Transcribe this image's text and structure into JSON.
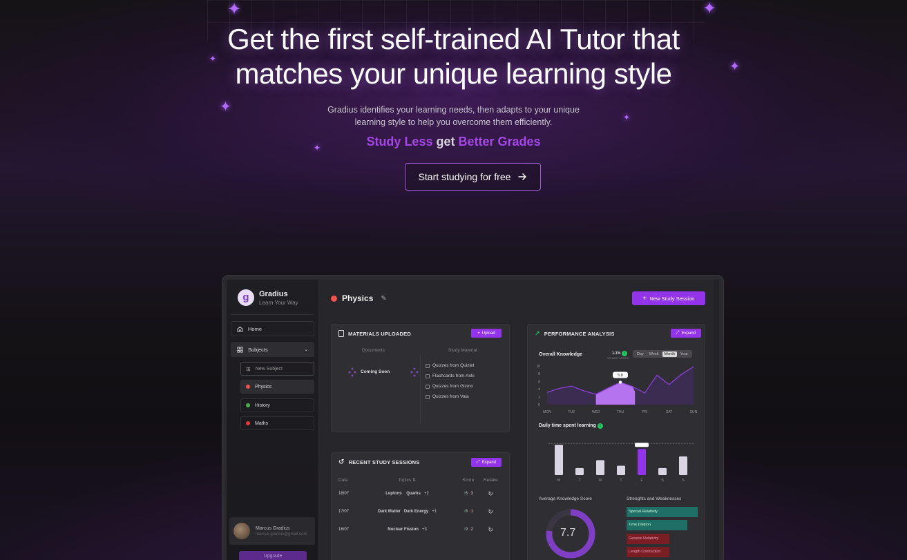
{
  "hero": {
    "title_line1": "Get the first self-trained AI Tutor that",
    "title_line2": "matches your unique learning style",
    "subtitle_line1": "Gradius identifies your learning needs, then adapts to your unique",
    "subtitle_line2": "learning style to help you overcome them efficiently.",
    "tagline_part1": "Study Less",
    "tagline_part2": "get",
    "tagline_part3": "Better Grades",
    "cta_label": "Start studying for free",
    "cta_icon": "arrow-right-icon"
  },
  "colors": {
    "accent": "#9333ea",
    "tagline_purple": "#a447e6",
    "background": "#121113"
  },
  "app": {
    "brand": {
      "name": "Gradius",
      "tagline": "Learn Your Way",
      "logo_letter": "g"
    },
    "sidebar": {
      "home": "Home",
      "subjects": "Subjects",
      "new_subject": "New Subject",
      "items": [
        {
          "label": "Physics",
          "color": "#ef5350"
        },
        {
          "label": "History",
          "color": "#4caf50"
        },
        {
          "label": "Maths",
          "color": "#e53935"
        }
      ],
      "user_name": "Marcus Gradius",
      "user_email": "marcus.gradius@gmail.com",
      "upgrade": "Upgrade"
    },
    "header": {
      "subject": "Physics",
      "subject_color": "#ef5350",
      "new_session": "New Study Session"
    },
    "materials": {
      "title": "MATERIALS UPLOADED",
      "upload": "Upload",
      "documents_header": "Documents",
      "study_material_header": "Study Material",
      "coming_soon": "Coming Soon",
      "items": [
        "Quizzes from Quizlet",
        "Flashcards from Anki",
        "Quizzes from Gizmo",
        "Quizzes from Vaia"
      ]
    },
    "sessions": {
      "title": "RECENT STUDY SESSIONS",
      "expand": "Expand",
      "headers": [
        "Date",
        "Topics",
        "Score",
        "Retake"
      ],
      "rows": [
        {
          "date": "18/07",
          "topic1": "Leptons",
          "topic2": "Quarks",
          "more": "+2",
          "up": "6",
          "down": "3"
        },
        {
          "date": "17/07",
          "topic1": "Dark Matter",
          "topic2": "Dark Energy",
          "more": "+1",
          "up": "8",
          "down": "1"
        },
        {
          "date": "16/07",
          "topic1": "Nuclear Fission",
          "topic2": "",
          "more": "+3",
          "up": "9",
          "down": "2"
        }
      ]
    },
    "performance": {
      "title": "PERFORMANCE ANALYSIS",
      "expand": "Expand",
      "overall_label": "Overall Knowledge",
      "overall_change": "1.3%",
      "overall_caption": "VS LAST MONTH",
      "ranges": [
        "Day",
        "Week",
        "Month",
        "Year"
      ],
      "selected_range": "Month",
      "daily_label": "Daily time spent learning",
      "avg_label": "Average Knowledge Score",
      "avg_score": "7.7",
      "sw_label": "Strenghts and Weaknesses",
      "strengths": [
        {
          "label": "Special Relativity",
          "color": "#1f6f66"
        },
        {
          "label": "Time Dilation",
          "color": "#1f6f66"
        },
        {
          "label": "General Relativity",
          "color": "#7a1e24"
        },
        {
          "label": "Length Contraction",
          "color": "#7a1e24"
        }
      ]
    }
  },
  "chart_data": [
    {
      "type": "area",
      "title": "Overall Knowledge",
      "categories": [
        "MON",
        "TUE",
        "WED",
        "THU",
        "FRI",
        "SAT",
        "SUN"
      ],
      "x": [
        0,
        0.5,
        1,
        1.5,
        2,
        2.5,
        3,
        3.5,
        4,
        4.5,
        5,
        5.5,
        6
      ],
      "values": [
        3.2,
        4.2,
        4.8,
        3.6,
        2.7,
        4.3,
        5.8,
        4.7,
        3.0,
        7.6,
        5.2,
        7.8,
        9.8
      ],
      "highlight_label": "5.8",
      "yticks": [
        0,
        2,
        4,
        6,
        8,
        10
      ],
      "ylim": [
        0,
        10
      ]
    },
    {
      "type": "bar",
      "title": "Daily time spent learning",
      "categories": [
        "M",
        "T",
        "W",
        "T",
        "F",
        "S",
        "S"
      ],
      "values": [
        6.5,
        1.5,
        3.2,
        2.0,
        5.6,
        1.5,
        4.0
      ],
      "highlight_index": 4,
      "ylim": [
        0,
        8
      ]
    },
    {
      "type": "pie",
      "title": "Average Knowledge Score",
      "values": [
        7.7
      ],
      "max": 10
    }
  ]
}
